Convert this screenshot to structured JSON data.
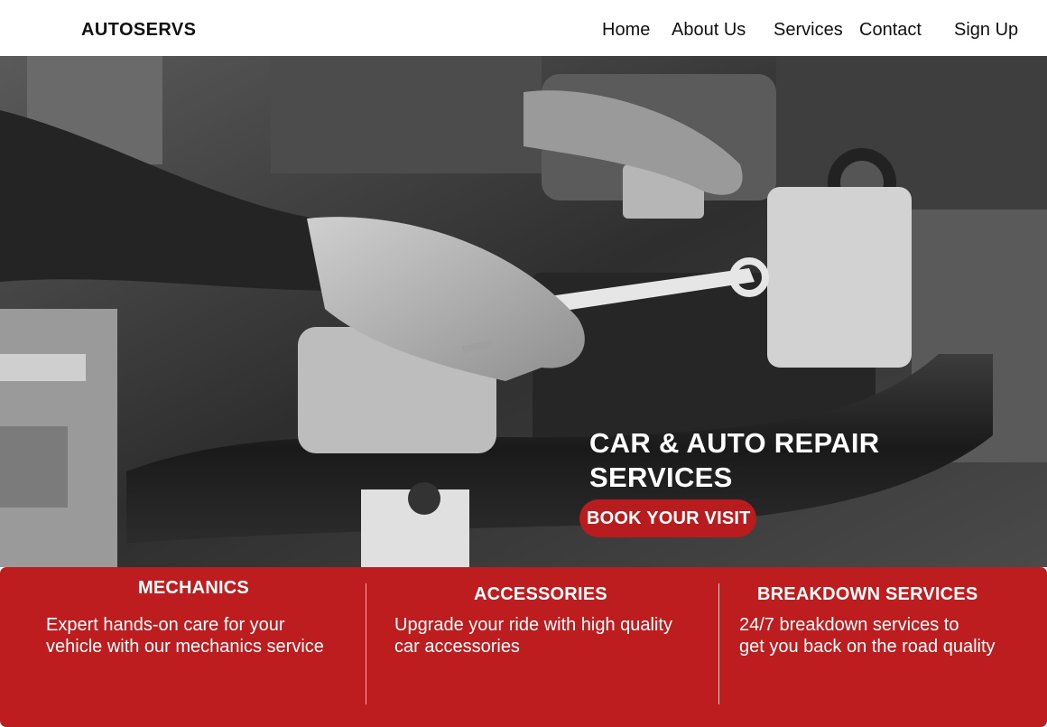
{
  "brand": "AUTOSERVS",
  "nav": {
    "home": "Home",
    "about": "About Us",
    "services": "Services",
    "contact": "Contact",
    "signup": "Sign Up"
  },
  "hero": {
    "title_line1": "CAR & AUTO REPAIR",
    "title_line2": "SERVICES",
    "cta": "BOOK YOUR VISIT",
    "image": "engine-bay-repair-photo-grayscale"
  },
  "services": [
    {
      "title": "MECHANICS",
      "desc_line1": "Expert hands-on care for your",
      "desc_line2": "vehicle with our mechanics service"
    },
    {
      "title": "ACCESSORIES",
      "desc_line1": "Upgrade your ride with high quality",
      "desc_line2": "car accessories"
    },
    {
      "title": "BREAKDOWN SERVICES",
      "desc_line1": "24/7 breakdown services to",
      "desc_line2": "get you back on the road quality"
    }
  ],
  "colors": {
    "accent": "#bd1d1e",
    "header_bg": "#ffffff",
    "text_dark": "#111111"
  }
}
